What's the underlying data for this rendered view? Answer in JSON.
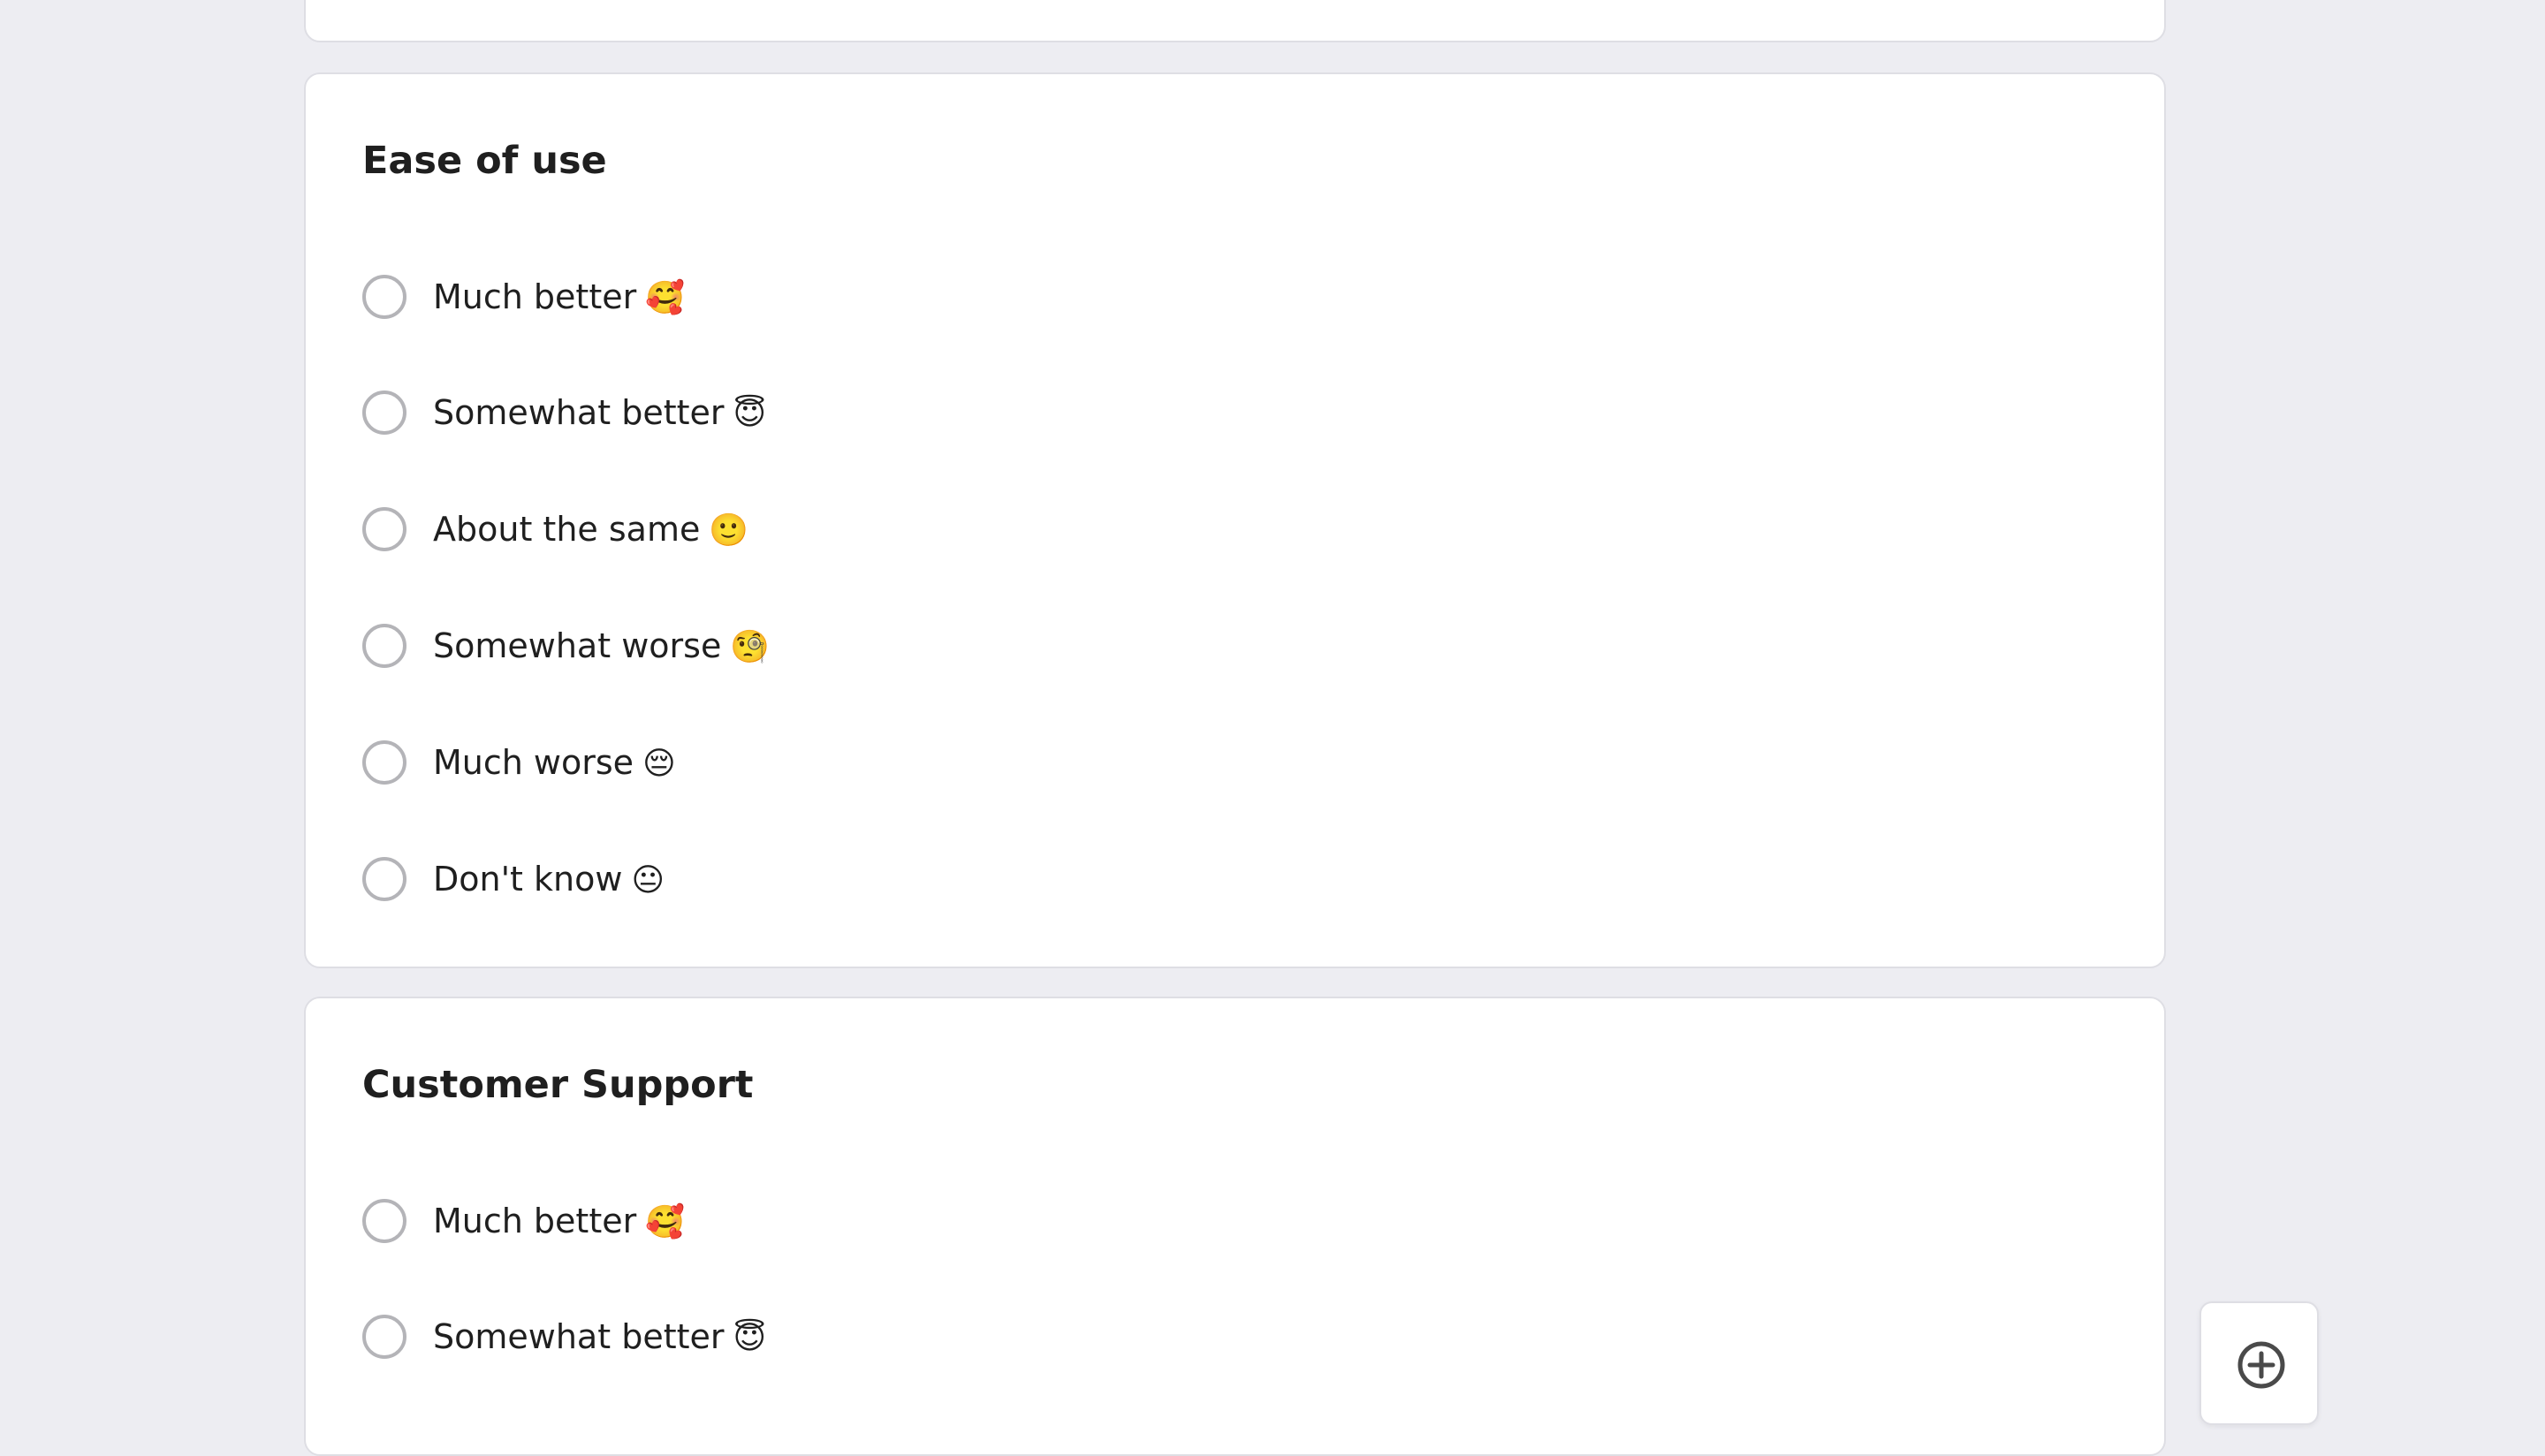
{
  "sections": [
    {
      "title": "Ease of use",
      "options": [
        {
          "label": "Much better",
          "emoji": "🥰"
        },
        {
          "label": "Somewhat better",
          "emoji": "😇"
        },
        {
          "label": "About the same",
          "emoji": "🙂"
        },
        {
          "label": "Somewhat worse",
          "emoji": "🧐"
        },
        {
          "label": "Much worse",
          "emoji": "😔"
        },
        {
          "label": "Don't know",
          "emoji": "😐"
        }
      ]
    },
    {
      "title": "Customer Support",
      "options": [
        {
          "label": "Much better",
          "emoji": "🥰"
        },
        {
          "label": "Somewhat better",
          "emoji": "😇"
        }
      ]
    }
  ],
  "fab": {
    "icon": "plus-circle-icon"
  },
  "colors": {
    "background": "#ededf2",
    "card": "#ffffff",
    "border": "#dedee4",
    "radio_border": "#b4b4b8",
    "text": "#1f1f1f"
  }
}
